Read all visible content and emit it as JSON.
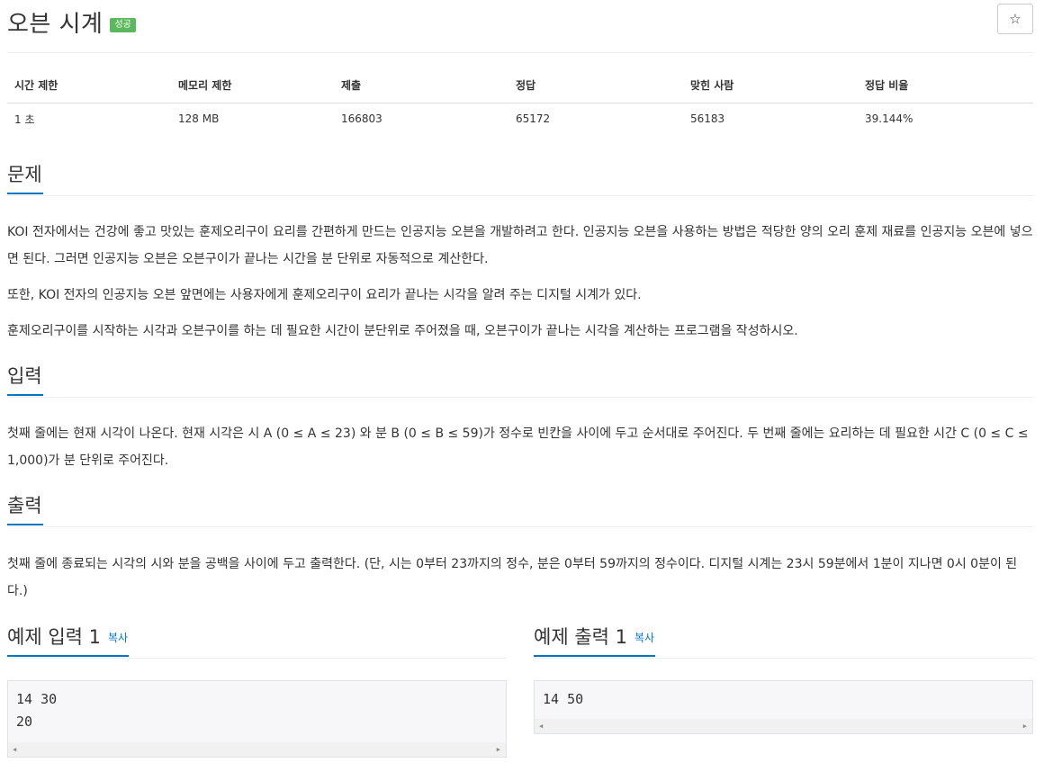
{
  "problem": {
    "title": "오븐 시계",
    "badge": "성공",
    "star": "☆"
  },
  "info": {
    "headers": [
      "시간 제한",
      "메모리 제한",
      "제출",
      "정답",
      "맞힌 사람",
      "정답 비율"
    ],
    "values": [
      "1 초",
      "128 MB",
      "166803",
      "65172",
      "56183",
      "39.144%"
    ]
  },
  "sections": {
    "problem_title": "문제",
    "problem_text": [
      "KOI 전자에서는 건강에 좋고 맛있는 훈제오리구이 요리를 간편하게 만드는 인공지능 오븐을 개발하려고 한다. 인공지능 오븐을 사용하는 방법은 적당한 양의 오리 훈제 재료를 인공지능 오븐에 넣으면 된다. 그러면 인공지능 오븐은 오븐구이가 끝나는 시간을 분 단위로 자동적으로 계산한다.",
      "또한, KOI 전자의 인공지능 오븐 앞면에는 사용자에게 훈제오리구이 요리가 끝나는 시각을 알려 주는 디지털 시계가 있다.",
      "훈제오리구이를 시작하는 시각과 오븐구이를 하는 데 필요한 시간이 분단위로 주어졌을 때, 오븐구이가 끝나는 시각을 계산하는 프로그램을 작성하시오."
    ],
    "input_title": "입력",
    "input_text": "첫째 줄에는 현재 시각이 나온다. 현재 시각은 시 A (0 ≤ A ≤ 23) 와 분 B (0 ≤ B ≤ 59)가 정수로 빈칸을 사이에 두고 순서대로 주어진다. 두 번째 줄에는 요리하는 데 필요한 시간 C (0 ≤ C ≤ 1,000)가 분 단위로 주어진다.",
    "output_title": "출력",
    "output_text": "첫째 줄에 종료되는 시각의 시와 분을 공백을 사이에 두고 출력한다. (단, 시는 0부터 23까지의 정수, 분은 0부터 59까지의 정수이다. 디지털 시계는 23시 59분에서 1분이 지나면 0시 0분이 된다.)"
  },
  "samples": {
    "input_title": "예제 입력 1",
    "output_title": "예제 출력 1",
    "copy_label": "복사",
    "input_value": "14 30\n20",
    "output_value": "14 50",
    "scroll_left": "◀",
    "scroll_right": "▶"
  }
}
